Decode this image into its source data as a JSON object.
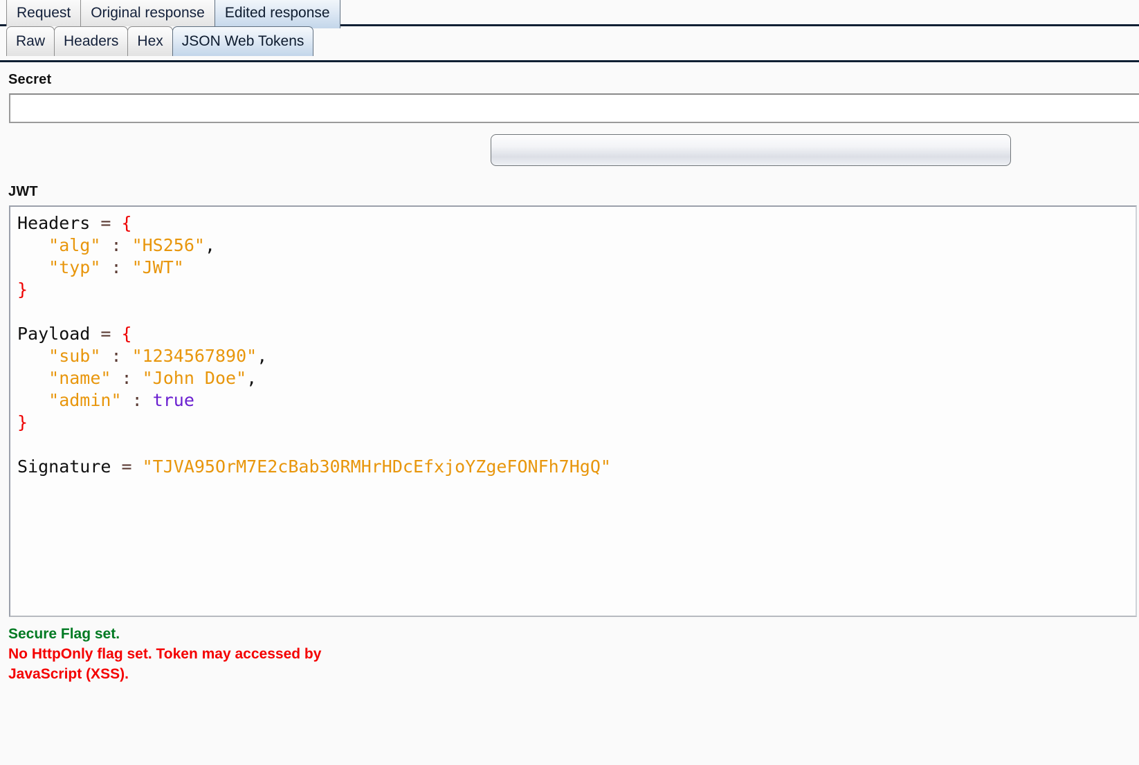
{
  "outer_tabs": [
    {
      "label": "Request",
      "active": false
    },
    {
      "label": "Original response",
      "active": false
    },
    {
      "label": "Edited response",
      "active": true
    }
  ],
  "inner_tabs": [
    {
      "label": "Raw",
      "active": false
    },
    {
      "label": "Headers",
      "active": false
    },
    {
      "label": "Hex",
      "active": false
    },
    {
      "label": "JSON Web Tokens",
      "active": true
    }
  ],
  "secret": {
    "label": "Secret",
    "value": "",
    "placeholder": ""
  },
  "action_button": {
    "label": ""
  },
  "jwt": {
    "label": "JWT",
    "lines": [
      {
        "segments": [
          {
            "text": "Headers",
            "cls": "k-name"
          },
          {
            "text": " = ",
            "cls": "k-eq"
          },
          {
            "text": "{",
            "cls": "k-brace"
          }
        ]
      },
      {
        "segments": [
          {
            "text": "   ",
            "cls": "k-name"
          },
          {
            "text": "\"alg\"",
            "cls": "k-str"
          },
          {
            "text": " : ",
            "cls": "k-colon"
          },
          {
            "text": "\"HS256\"",
            "cls": "k-str"
          },
          {
            "text": ",",
            "cls": "k-comma"
          }
        ]
      },
      {
        "segments": [
          {
            "text": "   ",
            "cls": "k-name"
          },
          {
            "text": "\"typ\"",
            "cls": "k-str"
          },
          {
            "text": " : ",
            "cls": "k-colon"
          },
          {
            "text": "\"JWT\"",
            "cls": "k-str"
          }
        ]
      },
      {
        "segments": [
          {
            "text": "}",
            "cls": "k-brace"
          }
        ]
      },
      {
        "segments": [
          {
            "text": "",
            "cls": "k-name"
          }
        ]
      },
      {
        "segments": [
          {
            "text": "Payload",
            "cls": "k-name"
          },
          {
            "text": " = ",
            "cls": "k-eq"
          },
          {
            "text": "{",
            "cls": "k-brace"
          }
        ]
      },
      {
        "segments": [
          {
            "text": "   ",
            "cls": "k-name"
          },
          {
            "text": "\"sub\"",
            "cls": "k-str"
          },
          {
            "text": " : ",
            "cls": "k-colon"
          },
          {
            "text": "\"1234567890\"",
            "cls": "k-str"
          },
          {
            "text": ",",
            "cls": "k-comma"
          }
        ]
      },
      {
        "segments": [
          {
            "text": "   ",
            "cls": "k-name"
          },
          {
            "text": "\"name\"",
            "cls": "k-str"
          },
          {
            "text": " : ",
            "cls": "k-colon"
          },
          {
            "text": "\"John Doe\"",
            "cls": "k-str"
          },
          {
            "text": ",",
            "cls": "k-comma"
          }
        ]
      },
      {
        "segments": [
          {
            "text": "   ",
            "cls": "k-name"
          },
          {
            "text": "\"admin\"",
            "cls": "k-str"
          },
          {
            "text": " : ",
            "cls": "k-colon"
          },
          {
            "text": "true",
            "cls": "k-bool"
          }
        ]
      },
      {
        "segments": [
          {
            "text": "}",
            "cls": "k-brace"
          }
        ]
      },
      {
        "segments": [
          {
            "text": "",
            "cls": "k-name"
          }
        ]
      },
      {
        "segments": [
          {
            "text": "Signature",
            "cls": "k-name"
          },
          {
            "text": " = ",
            "cls": "k-eq"
          },
          {
            "text": "\"TJVA95OrM7E2cBab30RMHrHDcEfxjoYZgeFONFh7HgQ\"",
            "cls": "k-str"
          }
        ]
      }
    ]
  },
  "status": {
    "secure_flag": "Secure Flag set.",
    "httponly_warning_line1": "No HttpOnly flag set. Token may accessed by",
    "httponly_warning_line2": "JavaScript (XSS).",
    "ok_color": "#007a22",
    "warn_color": "#f40000"
  }
}
